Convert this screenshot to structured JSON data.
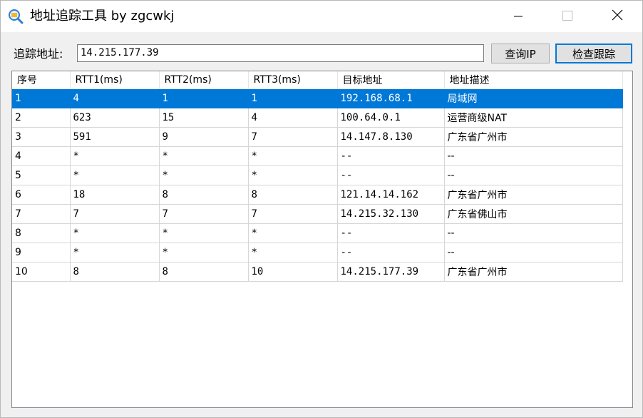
{
  "window": {
    "title": "地址追踪工具 by zgcwkj"
  },
  "toolbar": {
    "address_label": "追踪地址:",
    "address_value": "14.215.177.39",
    "query_ip_label": "查询IP",
    "trace_label": "检查跟踪"
  },
  "table": {
    "headers": [
      "序号",
      "RTT1(ms)",
      "RTT2(ms)",
      "RTT3(ms)",
      "目标地址",
      "地址描述"
    ],
    "rows": [
      [
        "1",
        "4",
        "1",
        "1",
        "192.168.68.1",
        "局域网"
      ],
      [
        "2",
        "623",
        "15",
        "4",
        "100.64.0.1",
        "运营商级NAT"
      ],
      [
        "3",
        "591",
        "9",
        "7",
        "14.147.8.130",
        "广东省广州市"
      ],
      [
        "4",
        "*",
        "*",
        "*",
        "--",
        "--"
      ],
      [
        "5",
        "*",
        "*",
        "*",
        "--",
        "--"
      ],
      [
        "6",
        "18",
        "8",
        "8",
        "121.14.14.162",
        "广东省广州市"
      ],
      [
        "7",
        "7",
        "7",
        "7",
        "14.215.32.130",
        "广东省佛山市"
      ],
      [
        "8",
        "*",
        "*",
        "*",
        "--",
        "--"
      ],
      [
        "9",
        "*",
        "*",
        "*",
        "--",
        "--"
      ],
      [
        "10",
        "8",
        "8",
        "10",
        "14.215.177.39",
        "广东省广州市"
      ]
    ],
    "selected_row": 0
  },
  "colors": {
    "selection": "#0078d7",
    "accent": "#0078d7"
  }
}
